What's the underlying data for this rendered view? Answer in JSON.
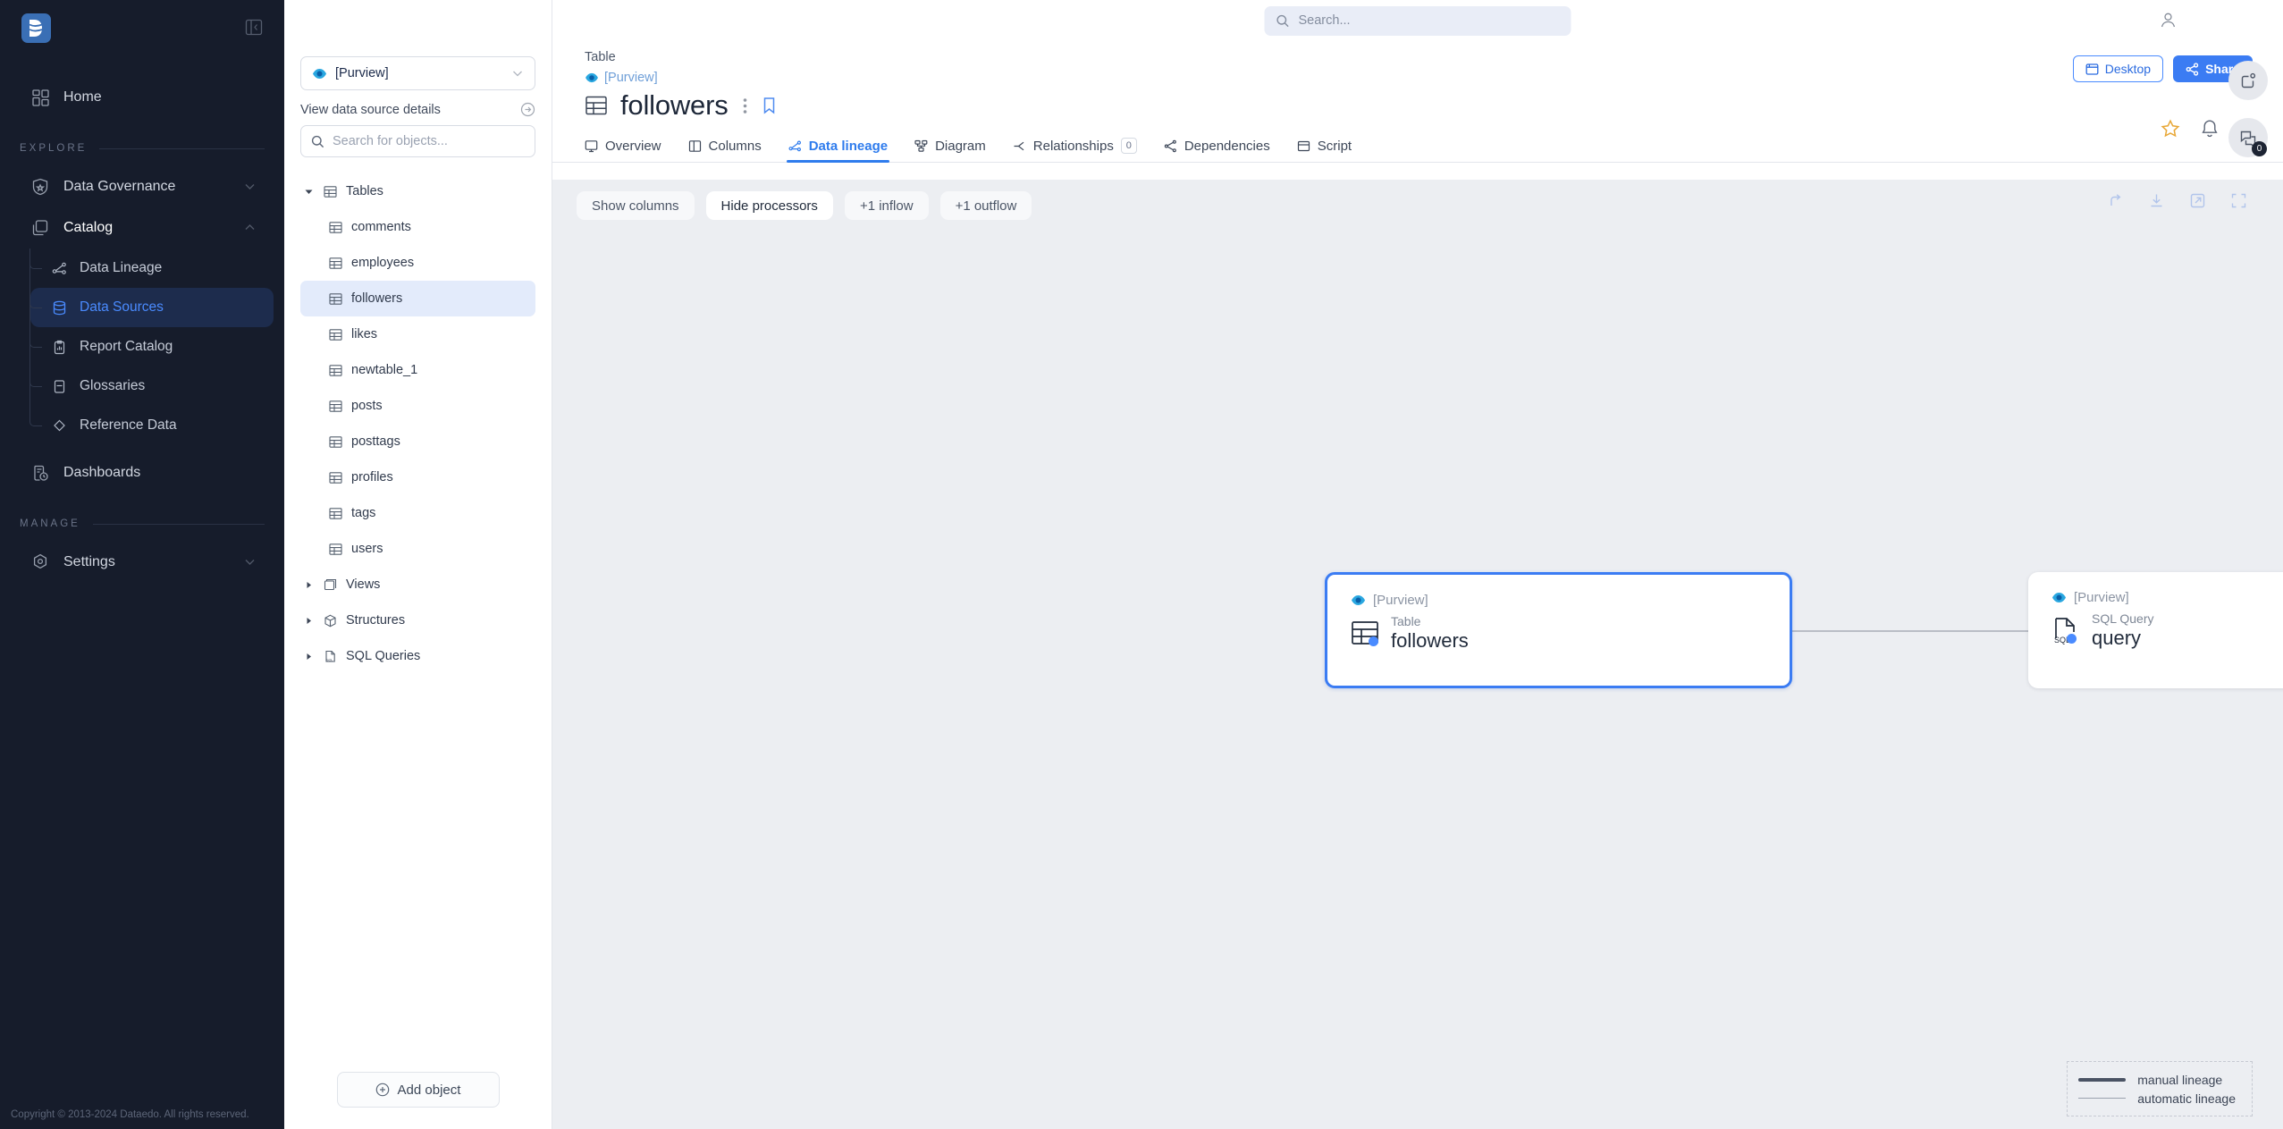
{
  "sidebar": {
    "logo_alt": "dataedo-logo",
    "home": {
      "label": "Home",
      "icon": "grid-icon"
    },
    "explore_label": "EXPLORE",
    "manage_label": "MANAGE",
    "groups": [
      {
        "label": "Data Governance",
        "icon": "shield-icon",
        "expanded": false
      },
      {
        "label": "Catalog",
        "icon": "layers-icon",
        "expanded": true
      }
    ],
    "catalog_children": [
      {
        "label": "Data Lineage",
        "icon": "lineage-icon",
        "active": false
      },
      {
        "label": "Data Sources",
        "icon": "database-icon",
        "active": true
      },
      {
        "label": "Report Catalog",
        "icon": "clipboard-icon",
        "active": false
      },
      {
        "label": "Glossaries",
        "icon": "book-icon",
        "active": false
      },
      {
        "label": "Reference Data",
        "icon": "diamond-icon",
        "active": false
      }
    ],
    "dashboards": {
      "label": "Dashboards",
      "icon": "dashboard-icon"
    },
    "settings": {
      "label": "Settings",
      "icon": "gear-icon"
    },
    "copyright": "Copyright © 2013-2024 Dataedo. All rights reserved."
  },
  "tree": {
    "datasource": "[Purview]",
    "details_link": "View data source details",
    "search_placeholder": "Search for objects...",
    "search_value": "",
    "add_object_label": "Add object",
    "root": {
      "label": "Tables",
      "icon": "table-icon",
      "expanded": true
    },
    "tables": [
      "comments",
      "employees",
      "followers",
      "likes",
      "newtable_1",
      "posts",
      "posttags",
      "profiles",
      "tags",
      "users"
    ],
    "selected_table": "followers",
    "collapsed_groups": [
      {
        "label": "Views",
        "icon": "views-icon"
      },
      {
        "label": "Structures",
        "icon": "structure-icon"
      },
      {
        "label": "SQL Queries",
        "icon": "sql-icon"
      }
    ]
  },
  "topbar": {
    "search_placeholder": "Search...",
    "search_value": "",
    "user_icon": "user-icon"
  },
  "header": {
    "object_type": "Table",
    "source": "[Purview]",
    "title": "followers",
    "desktop_label": "Desktop",
    "share_label": "Share"
  },
  "tabs": [
    {
      "label": "Overview",
      "icon": "overview-icon",
      "active": false,
      "badge": null
    },
    {
      "label": "Columns",
      "icon": "columns-icon",
      "active": false,
      "badge": null
    },
    {
      "label": "Data lineage",
      "icon": "lineage-icon",
      "active": true,
      "badge": null
    },
    {
      "label": "Diagram",
      "icon": "diagram-icon",
      "active": false,
      "badge": null
    },
    {
      "label": "Relationships",
      "icon": "relationship-icon",
      "active": false,
      "badge": "0"
    },
    {
      "label": "Dependencies",
      "icon": "dependencies-icon",
      "active": false,
      "badge": null
    },
    {
      "label": "Script",
      "icon": "script-icon",
      "active": false,
      "badge": null
    }
  ],
  "lineage": {
    "toolbar": [
      {
        "label": "Show columns",
        "strong": false
      },
      {
        "label": "Hide processors",
        "strong": true
      },
      {
        "label": "+1 inflow",
        "strong": false
      },
      {
        "label": "+1 outflow",
        "strong": false
      }
    ],
    "tools": [
      "share-icon",
      "download-icon",
      "open-external-icon",
      "fullscreen-icon"
    ],
    "nodes": [
      {
        "source": "[Purview]",
        "type": "Table",
        "name": "followers",
        "icon": "table-icon",
        "selected": true
      },
      {
        "source": "[Purview]",
        "type": "SQL Query",
        "name": "query",
        "icon": "sql-file-icon",
        "selected": false
      }
    ],
    "legend": [
      {
        "label": "manual lineage",
        "style": "manual"
      },
      {
        "label": "automatic lineage",
        "style": "automatic"
      }
    ]
  },
  "right_rail": {
    "buttons": [
      {
        "icon": "note-icon",
        "badge": null
      },
      {
        "icon": "comments-icon",
        "badge": "0"
      }
    ]
  },
  "colors": {
    "accent": "#3b7cf3",
    "sidebar_bg": "#161c2b",
    "canvas_bg": "#eceef2",
    "selected_tree": "#e3ebfb"
  }
}
